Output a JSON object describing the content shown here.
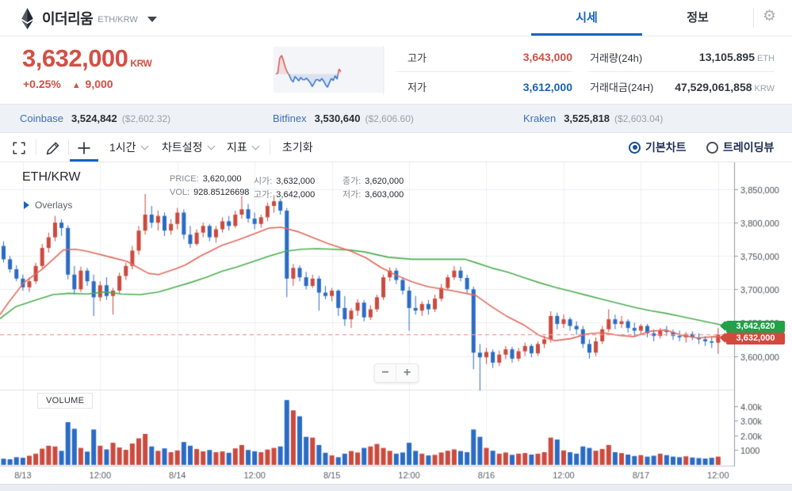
{
  "colors": {
    "red": "#d24f45",
    "blue": "#1763b6",
    "candle_up": "#cb4a3e",
    "candle_down": "#2a6bc4",
    "ma_fast": "#e4695c",
    "ma_slow": "#4cae50",
    "badge_up_bg": "#22a148",
    "badge_price_bg": "#d2493e",
    "accent": "#1565c0",
    "dashed_line": "#f09a92"
  },
  "header": {
    "coin_name": "이더리움",
    "pair": "ETH/KRW",
    "tabs": [
      {
        "label": "시세",
        "active": true
      },
      {
        "label": "정보",
        "active": false
      }
    ],
    "gear_icon": "⚙"
  },
  "summary": {
    "price": "3,632,000",
    "currency": "KRW",
    "change_pct": "+0.25%",
    "change_arrow": "▲",
    "change_amt": "9,000",
    "stats": [
      {
        "label": "고가",
        "value": "3,643,000",
        "color": "red"
      },
      {
        "label": "저가",
        "value": "3,612,000",
        "color": "blue"
      },
      {
        "label": "거래량(24h)",
        "value": "13,105.895",
        "unit": "ETH"
      },
      {
        "label": "거래대금(24H)",
        "value": "47,529,061,858",
        "unit": "KRW"
      }
    ],
    "sparkline": {
      "base": 45,
      "values": [
        45,
        48,
        88,
        95,
        80,
        62,
        50,
        42,
        30,
        24,
        38,
        33,
        27,
        36,
        30,
        30,
        34,
        28,
        22,
        12,
        20,
        30,
        30,
        26,
        33,
        26,
        16,
        10,
        22,
        33,
        28,
        40,
        32,
        58,
        52
      ]
    }
  },
  "exchanges": [
    {
      "name": "Coinbase",
      "price": "3,524,842",
      "usd": "($2,602.32)"
    },
    {
      "name": "Bitfinex",
      "price": "3,530,640",
      "usd": "($2,606.60)"
    },
    {
      "name": "Kraken",
      "price": "3,525,818",
      "usd": "($2,603.04)"
    }
  ],
  "toolbar": {
    "interval": "1시간",
    "chart_settings": "차트설정",
    "indicator": "지표",
    "reset": "초기화",
    "chart_type": [
      {
        "label": "기본차트",
        "selected": true
      },
      {
        "label": "트레이딩뷰",
        "selected": false
      }
    ]
  },
  "chart": {
    "symbol_label": "ETH/KRW",
    "overlays_label": "Overlays",
    "volume_label": "VOLUME",
    "legend_rows": [
      [
        {
          "label": "PRICE:",
          "value": "3,620,000"
        },
        {
          "label": "시가:",
          "value": "3,632,000"
        },
        {
          "label": "종가:",
          "value": "3,620,000"
        }
      ],
      [
        {
          "label": "VOL:",
          "value": "928.85126698"
        },
        {
          "label": "고가:",
          "value": "3,642,000"
        },
        {
          "label": "저가:",
          "value": "3,603,000"
        }
      ]
    ],
    "badges": {
      "ma_value": "3,642,620",
      "price_value": "3,632,000"
    },
    "zoom_out_label": "−",
    "zoom_in_label": "+"
  },
  "chart_data": {
    "type": "candlestick+volume",
    "interval": "1h",
    "price_unit": "thousand KRW",
    "current_price": 3632,
    "price_ticks": [
      {
        "v": 3850,
        "label": "3,850,000"
      },
      {
        "v": 3800,
        "label": "3,800,000"
      },
      {
        "v": 3750,
        "label": "3,750,000"
      },
      {
        "v": 3700,
        "label": "3,700,000"
      },
      {
        "v": 3650,
        "label": "3,650,000"
      },
      {
        "v": 3600,
        "label": "3,600,000"
      }
    ],
    "volume_ticks": [
      {
        "v": 4000,
        "label": "4.00k"
      },
      {
        "v": 3000,
        "label": "3.00k"
      },
      {
        "v": 2000,
        "label": "2.00k"
      },
      {
        "v": 1000,
        "label": "1000"
      }
    ],
    "time_ticks": [
      {
        "i": 3,
        "label": "8/13"
      },
      {
        "i": 15,
        "label": "12:00"
      },
      {
        "i": 27,
        "label": "8/14"
      },
      {
        "i": 39,
        "label": "12:00"
      },
      {
        "i": 51,
        "label": "8/15"
      },
      {
        "i": 63,
        "label": "12:00"
      },
      {
        "i": 75,
        "label": "8/16"
      },
      {
        "i": 87,
        "label": "12:00"
      },
      {
        "i": 99,
        "label": "8/17"
      },
      {
        "i": 111,
        "label": "12:00"
      }
    ],
    "candles": [
      [
        3765,
        3772,
        3740,
        3745,
        420
      ],
      [
        3745,
        3750,
        3725,
        3730,
        380
      ],
      [
        3730,
        3736,
        3712,
        3716,
        520
      ],
      [
        3716,
        3722,
        3698,
        3703,
        480
      ],
      [
        3703,
        3718,
        3696,
        3712,
        620
      ],
      [
        3712,
        3740,
        3708,
        3735,
        760
      ],
      [
        3735,
        3768,
        3730,
        3762,
        1100
      ],
      [
        3762,
        3785,
        3755,
        3778,
        1300
      ],
      [
        3778,
        3810,
        3772,
        3800,
        1250
      ],
      [
        3800,
        3805,
        3780,
        3792,
        950
      ],
      [
        3792,
        3796,
        3715,
        3722,
        2900
      ],
      [
        3722,
        3735,
        3692,
        3700,
        2450
      ],
      [
        3700,
        3734,
        3696,
        3728,
        1150
      ],
      [
        3728,
        3732,
        3705,
        3712,
        900
      ],
      [
        3712,
        3722,
        3660,
        3688,
        2400
      ],
      [
        3688,
        3712,
        3682,
        3706,
        1300
      ],
      [
        3706,
        3718,
        3684,
        3690,
        1050
      ],
      [
        3690,
        3702,
        3662,
        3698,
        1500
      ],
      [
        3698,
        3725,
        3694,
        3720,
        1180
      ],
      [
        3720,
        3740,
        3714,
        3735,
        1020
      ],
      [
        3735,
        3765,
        3730,
        3758,
        1450
      ],
      [
        3758,
        3795,
        3752,
        3788,
        1800
      ],
      [
        3788,
        3843,
        3782,
        3812,
        2100
      ],
      [
        3812,
        3825,
        3792,
        3800,
        1250
      ],
      [
        3800,
        3818,
        3788,
        3810,
        950
      ],
      [
        3810,
        3815,
        3780,
        3788,
        1120
      ],
      [
        3788,
        3805,
        3782,
        3798,
        860
      ],
      [
        3798,
        3822,
        3790,
        3815,
        980
      ],
      [
        3815,
        3820,
        3775,
        3782,
        1550
      ],
      [
        3782,
        3795,
        3762,
        3768,
        1300
      ],
      [
        3768,
        3790,
        3765,
        3785,
        1080
      ],
      [
        3785,
        3800,
        3778,
        3795,
        920
      ],
      [
        3795,
        3798,
        3772,
        3778,
        1010
      ],
      [
        3778,
        3795,
        3770,
        3790,
        860
      ],
      [
        3790,
        3808,
        3785,
        3802,
        910
      ],
      [
        3802,
        3810,
        3788,
        3795,
        820
      ],
      [
        3795,
        3818,
        3792,
        3812,
        1120
      ],
      [
        3812,
        3840,
        3806,
        3820,
        1350
      ],
      [
        3820,
        3828,
        3800,
        3806,
        1010
      ],
      [
        3806,
        3815,
        3790,
        3798,
        920
      ],
      [
        3798,
        3812,
        3792,
        3808,
        860
      ],
      [
        3808,
        3830,
        3802,
        3825,
        1040
      ],
      [
        3825,
        3841,
        3815,
        3832,
        1150
      ],
      [
        3832,
        3836,
        3812,
        3818,
        1250
      ],
      [
        3818,
        3822,
        3688,
        3716,
        4400
      ],
      [
        3716,
        3738,
        3705,
        3732,
        3700
      ],
      [
        3732,
        3736,
        3712,
        3718,
        3300
      ],
      [
        3718,
        3726,
        3700,
        3705,
        1900
      ],
      [
        3705,
        3722,
        3702,
        3716,
        1850
      ],
      [
        3716,
        3720,
        3668,
        3695,
        1350
      ],
      [
        3695,
        3705,
        3685,
        3690,
        820
      ],
      [
        3690,
        3702,
        3682,
        3698,
        640
      ],
      [
        3698,
        3700,
        3660,
        3672,
        520
      ],
      [
        3672,
        3690,
        3645,
        3655,
        760
      ],
      [
        3655,
        3672,
        3642,
        3668,
        940
      ],
      [
        3668,
        3685,
        3660,
        3680,
        840
      ],
      [
        3680,
        3684,
        3652,
        3658,
        1150
      ],
      [
        3658,
        3676,
        3654,
        3670,
        1250
      ],
      [
        3670,
        3692,
        3666,
        3688,
        1420
      ],
      [
        3688,
        3722,
        3684,
        3718,
        1150
      ],
      [
        3718,
        3733,
        3712,
        3728,
        950
      ],
      [
        3728,
        3732,
        3708,
        3714,
        760
      ],
      [
        3714,
        3718,
        3692,
        3698,
        840
      ],
      [
        3698,
        3704,
        3638,
        3672,
        1500
      ],
      [
        3672,
        3690,
        3662,
        3668,
        950
      ],
      [
        3668,
        3682,
        3660,
        3678,
        760
      ],
      [
        3678,
        3684,
        3662,
        3670,
        640
      ],
      [
        3670,
        3692,
        3666,
        3686,
        680
      ],
      [
        3686,
        3708,
        3682,
        3702,
        840
      ],
      [
        3702,
        3722,
        3698,
        3718,
        960
      ],
      [
        3718,
        3735,
        3714,
        3728,
        1050
      ],
      [
        3728,
        3734,
        3712,
        3717,
        940
      ],
      [
        3717,
        3722,
        3694,
        3700,
        860
      ],
      [
        3700,
        3704,
        3580,
        3605,
        2400
      ],
      [
        3605,
        3618,
        3548,
        3598,
        1900
      ],
      [
        3598,
        3612,
        3588,
        3606,
        1150
      ],
      [
        3606,
        3610,
        3582,
        3590,
        960
      ],
      [
        3590,
        3608,
        3585,
        3602,
        760
      ],
      [
        3602,
        3615,
        3595,
        3610,
        840
      ],
      [
        3610,
        3614,
        3590,
        3596,
        680
      ],
      [
        3596,
        3612,
        3592,
        3607,
        760
      ],
      [
        3607,
        3620,
        3600,
        3615,
        800
      ],
      [
        3615,
        3618,
        3598,
        3604,
        700
      ],
      [
        3604,
        3622,
        3600,
        3618,
        760
      ],
      [
        3618,
        3630,
        3612,
        3625,
        860
      ],
      [
        3625,
        3667,
        3620,
        3660,
        1850
      ],
      [
        3660,
        3665,
        3640,
        3648,
        1720
      ],
      [
        3648,
        3662,
        3642,
        3655,
        980
      ],
      [
        3655,
        3658,
        3638,
        3645,
        860
      ],
      [
        3645,
        3652,
        3632,
        3640,
        760
      ],
      [
        3640,
        3645,
        3612,
        3618,
        1250
      ],
      [
        3618,
        3625,
        3596,
        3605,
        1150
      ],
      [
        3605,
        3628,
        3600,
        3622,
        960
      ],
      [
        3622,
        3645,
        3618,
        3640,
        1080
      ],
      [
        3640,
        3670,
        3636,
        3655,
        1350
      ],
      [
        3655,
        3662,
        3640,
        3648,
        860
      ],
      [
        3648,
        3660,
        3642,
        3652,
        800
      ],
      [
        3652,
        3655,
        3635,
        3642,
        700
      ],
      [
        3642,
        3650,
        3630,
        3638,
        600
      ],
      [
        3638,
        3648,
        3632,
        3645,
        660
      ],
      [
        3645,
        3648,
        3628,
        3634,
        560
      ],
      [
        3634,
        3640,
        3622,
        3630,
        620
      ],
      [
        3630,
        3642,
        3626,
        3638,
        760
      ],
      [
        3638,
        3645,
        3630,
        3636,
        660
      ],
      [
        3636,
        3640,
        3624,
        3630,
        560
      ],
      [
        3630,
        3638,
        3622,
        3628,
        520
      ],
      [
        3628,
        3636,
        3620,
        3633,
        580
      ],
      [
        3633,
        3637,
        3624,
        3628,
        500
      ],
      [
        3628,
        3634,
        3618,
        3625,
        460
      ],
      [
        3625,
        3630,
        3615,
        3622,
        430
      ],
      [
        3622,
        3628,
        3612,
        3620,
        480
      ],
      [
        3620,
        3642,
        3603,
        3632,
        560
      ]
    ],
    "ma_fast": [
      [
        0,
        3662
      ],
      [
        10,
        3679
      ],
      [
        30,
        3710
      ],
      [
        53,
        3730
      ],
      [
        80,
        3759
      ],
      [
        95,
        3760
      ],
      [
        110,
        3757
      ],
      [
        140,
        3748
      ],
      [
        160,
        3742
      ],
      [
        187,
        3724
      ],
      [
        200,
        3722
      ],
      [
        220,
        3730
      ],
      [
        233,
        3736
      ],
      [
        253,
        3750
      ],
      [
        280,
        3766
      ],
      [
        300,
        3774
      ],
      [
        320,
        3783
      ],
      [
        340,
        3792
      ],
      [
        355,
        3793
      ],
      [
        377,
        3786
      ],
      [
        413,
        3769
      ],
      [
        443,
        3757
      ],
      [
        462,
        3747
      ],
      [
        480,
        3733
      ],
      [
        500,
        3721
      ],
      [
        520,
        3711
      ],
      [
        540,
        3704
      ],
      [
        570,
        3698
      ],
      [
        600,
        3691
      ],
      [
        620,
        3674
      ],
      [
        640,
        3659
      ],
      [
        660,
        3647
      ],
      [
        680,
        3631
      ],
      [
        700,
        3623
      ],
      [
        720,
        3626
      ],
      [
        740,
        3633
      ],
      [
        760,
        3635
      ],
      [
        780,
        3631
      ],
      [
        800,
        3629
      ],
      [
        820,
        3637
      ],
      [
        840,
        3639
      ],
      [
        860,
        3631
      ],
      [
        880,
        3627
      ],
      [
        900,
        3629
      ],
      [
        926,
        3628
      ]
    ],
    "ma_slow": [
      [
        0,
        3656
      ],
      [
        20,
        3674
      ],
      [
        43,
        3683
      ],
      [
        67,
        3692
      ],
      [
        87,
        3694
      ],
      [
        110,
        3693
      ],
      [
        133,
        3696
      ],
      [
        153,
        3693
      ],
      [
        177,
        3692
      ],
      [
        200,
        3696
      ],
      [
        220,
        3703
      ],
      [
        240,
        3710
      ],
      [
        260,
        3718
      ],
      [
        280,
        3727
      ],
      [
        300,
        3734
      ],
      [
        320,
        3742
      ],
      [
        340,
        3750
      ],
      [
        360,
        3757
      ],
      [
        380,
        3760
      ],
      [
        400,
        3761
      ],
      [
        420,
        3760
      ],
      [
        440,
        3759
      ],
      [
        460,
        3756
      ],
      [
        490,
        3748
      ],
      [
        520,
        3745
      ],
      [
        555,
        3745
      ],
      [
        587,
        3745
      ],
      [
        600,
        3740
      ],
      [
        620,
        3732
      ],
      [
        640,
        3726
      ],
      [
        660,
        3718
      ],
      [
        680,
        3710
      ],
      [
        700,
        3703
      ],
      [
        720,
        3697
      ],
      [
        740,
        3691
      ],
      [
        760,
        3685
      ],
      [
        780,
        3679
      ],
      [
        800,
        3673
      ],
      [
        820,
        3668
      ],
      [
        840,
        3664
      ],
      [
        860,
        3659
      ],
      [
        880,
        3654
      ],
      [
        900,
        3649
      ],
      [
        926,
        3642.6
      ]
    ]
  }
}
